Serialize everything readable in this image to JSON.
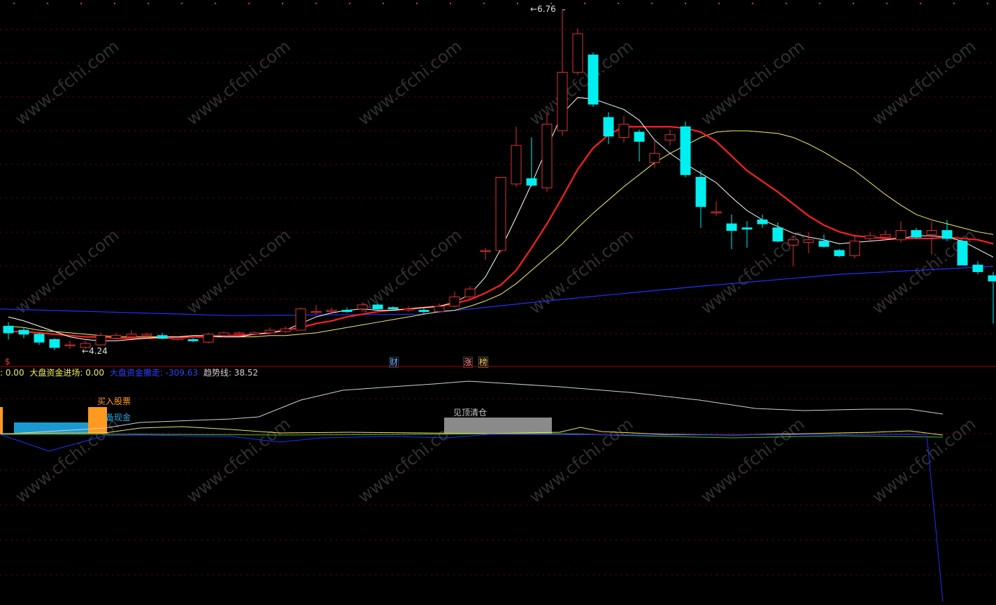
{
  "colors": {
    "background": "#000000",
    "grid": "#7a0000",
    "up": "#e0303a",
    "down": "#00f0f0",
    "ma5": "#ffffff",
    "ma10": "#ff2020",
    "ma20": "#f0f060",
    "ma60": "#2030ff",
    "divider": "#b00000"
  },
  "price": {
    "high_label": "6.76",
    "low_label": "4.24",
    "high_marker_arrow": "←",
    "low_marker_arrow": "←"
  },
  "event_markers": [
    {
      "text": "$",
      "color": "#ff3030"
    },
    {
      "text": "财",
      "color": "#60c0ff"
    },
    {
      "text": "涨",
      "color": "#ff9090"
    },
    {
      "text": "榜",
      "color": "#ffd070"
    }
  ],
  "indicator_bar": {
    "items": [
      {
        "label": ": 0.00",
        "color": "#f0f060"
      },
      {
        "label": "大盘资金进场: 0.00",
        "color": "#f0f060"
      },
      {
        "label": "大盘资金撤走: -309.63",
        "color": "#3040ff"
      },
      {
        "label": "趋势线: 38.52",
        "color": "#d0d0d0"
      }
    ]
  },
  "signals": {
    "buy_label": "买入股票",
    "hold_cash_label": "备现金",
    "top_clear_label": "见顶清仓"
  },
  "watermark": "www.cfchi.com",
  "chart_data": {
    "type": "candlestick",
    "y_high": 6.76,
    "y_low": 4.24,
    "candles": [
      {
        "o": 4.38,
        "c": 4.33,
        "h": 4.41,
        "l": 4.28
      },
      {
        "o": 4.35,
        "c": 4.32,
        "h": 4.37,
        "l": 4.29
      },
      {
        "o": 4.32,
        "c": 4.26,
        "h": 4.33,
        "l": 4.24
      },
      {
        "o": 4.28,
        "c": 4.22,
        "h": 4.29,
        "l": 4.2
      },
      {
        "o": 4.24,
        "c": 4.24,
        "h": 4.27,
        "l": 4.21
      },
      {
        "o": 4.22,
        "c": 4.25,
        "h": 4.27,
        "l": 4.21
      },
      {
        "o": 4.24,
        "c": 4.31,
        "h": 4.33,
        "l": 4.24
      },
      {
        "o": 4.29,
        "c": 4.31,
        "h": 4.33,
        "l": 4.28
      },
      {
        "o": 4.3,
        "c": 4.32,
        "h": 4.35,
        "l": 4.29
      },
      {
        "o": 4.31,
        "c": 4.32,
        "h": 4.33,
        "l": 4.29
      },
      {
        "o": 4.31,
        "c": 4.29,
        "h": 4.33,
        "l": 4.28
      },
      {
        "o": 4.28,
        "c": 4.29,
        "h": 4.3,
        "l": 4.27
      },
      {
        "o": 4.28,
        "c": 4.27,
        "h": 4.29,
        "l": 4.26
      },
      {
        "o": 4.26,
        "c": 4.32,
        "h": 4.33,
        "l": 4.25
      },
      {
        "o": 4.31,
        "c": 4.33,
        "h": 4.34,
        "l": 4.3
      },
      {
        "o": 4.32,
        "c": 4.33,
        "h": 4.34,
        "l": 4.31
      },
      {
        "o": 4.32,
        "c": 4.33,
        "h": 4.34,
        "l": 4.31
      },
      {
        "o": 4.33,
        "c": 4.35,
        "h": 4.37,
        "l": 4.32
      },
      {
        "o": 4.34,
        "c": 4.36,
        "h": 4.38,
        "l": 4.33
      },
      {
        "o": 4.35,
        "c": 4.51,
        "h": 4.52,
        "l": 4.35
      },
      {
        "o": 4.49,
        "c": 4.49,
        "h": 4.54,
        "l": 4.47
      },
      {
        "o": 4.49,
        "c": 4.5,
        "h": 4.52,
        "l": 4.47
      },
      {
        "o": 4.5,
        "c": 4.49,
        "h": 4.52,
        "l": 4.48
      },
      {
        "o": 4.51,
        "c": 4.54,
        "h": 4.56,
        "l": 4.49
      },
      {
        "o": 4.54,
        "c": 4.51,
        "h": 4.55,
        "l": 4.5
      },
      {
        "o": 4.52,
        "c": 4.51,
        "h": 4.53,
        "l": 4.5
      },
      {
        "o": 4.51,
        "c": 4.51,
        "h": 4.53,
        "l": 4.49
      },
      {
        "o": 4.5,
        "c": 4.49,
        "h": 4.52,
        "l": 4.47
      },
      {
        "o": 4.49,
        "c": 4.53,
        "h": 4.55,
        "l": 4.48
      },
      {
        "o": 4.53,
        "c": 4.6,
        "h": 4.64,
        "l": 4.52
      },
      {
        "o": 4.6,
        "c": 4.66,
        "h": 4.68,
        "l": 4.58
      },
      {
        "o": 4.95,
        "c": 4.95,
        "h": 4.97,
        "l": 4.88
      },
      {
        "o": 4.95,
        "c": 5.5,
        "h": 5.5,
        "l": 4.93
      },
      {
        "o": 5.45,
        "c": 5.74,
        "h": 5.88,
        "l": 5.43
      },
      {
        "o": 5.49,
        "c": 5.44,
        "h": 5.8,
        "l": 5.43
      },
      {
        "o": 5.42,
        "c": 5.9,
        "h": 5.98,
        "l": 5.39
      },
      {
        "o": 5.85,
        "c": 6.29,
        "h": 6.76,
        "l": 5.81
      },
      {
        "o": 6.29,
        "c": 6.58,
        "h": 6.62,
        "l": 6.27
      },
      {
        "o": 6.42,
        "c": 6.05,
        "h": 6.44,
        "l": 6.03
      },
      {
        "o": 5.95,
        "c": 5.81,
        "h": 5.99,
        "l": 5.75
      },
      {
        "o": 5.8,
        "c": 5.9,
        "h": 5.96,
        "l": 5.76
      },
      {
        "o": 5.84,
        "c": 5.77,
        "h": 5.86,
        "l": 5.62
      },
      {
        "o": 5.61,
        "c": 5.68,
        "h": 5.78,
        "l": 5.57
      },
      {
        "o": 5.78,
        "c": 5.82,
        "h": 5.86,
        "l": 5.74
      },
      {
        "o": 5.88,
        "c": 5.52,
        "h": 5.92,
        "l": 5.5
      },
      {
        "o": 5.5,
        "c": 5.28,
        "h": 5.55,
        "l": 5.12
      },
      {
        "o": 5.24,
        "c": 5.24,
        "h": 5.32,
        "l": 5.21
      },
      {
        "o": 5.15,
        "c": 5.1,
        "h": 5.22,
        "l": 4.96
      },
      {
        "o": 5.12,
        "c": 5.11,
        "h": 5.17,
        "l": 4.97
      },
      {
        "o": 5.18,
        "c": 5.15,
        "h": 5.22,
        "l": 5.12
      },
      {
        "o": 5.12,
        "c": 5.02,
        "h": 5.16,
        "l": 5.01
      },
      {
        "o": 4.99,
        "c": 5.03,
        "h": 5.06,
        "l": 4.83
      },
      {
        "o": 5.01,
        "c": 5.03,
        "h": 5.09,
        "l": 4.93
      },
      {
        "o": 5.02,
        "c": 4.98,
        "h": 5.07,
        "l": 4.97
      },
      {
        "o": 4.95,
        "c": 4.91,
        "h": 4.96,
        "l": 4.9
      },
      {
        "o": 4.91,
        "c": 5.02,
        "h": 5.06,
        "l": 4.89
      },
      {
        "o": 5.04,
        "c": 5.06,
        "h": 5.09,
        "l": 5.01
      },
      {
        "o": 5.05,
        "c": 5.07,
        "h": 5.1,
        "l": 5.03
      },
      {
        "o": 5.03,
        "c": 5.1,
        "h": 5.17,
        "l": 5.01
      },
      {
        "o": 5.1,
        "c": 5.05,
        "h": 5.12,
        "l": 5.04
      },
      {
        "o": 5.07,
        "c": 5.1,
        "h": 5.17,
        "l": 4.92
      },
      {
        "o": 5.1,
        "c": 5.04,
        "h": 5.18,
        "l": 5.02
      },
      {
        "o": 5.02,
        "c": 4.84,
        "h": 5.03,
        "l": 4.84
      },
      {
        "o": 4.84,
        "c": 4.79,
        "h": 4.87,
        "l": 4.77
      },
      {
        "o": 4.76,
        "c": 4.72,
        "h": 4.79,
        "l": 4.4
      }
    ],
    "ma5": [
      4.45,
      4.42,
      4.38,
      4.34,
      4.3,
      4.28,
      4.27,
      4.27,
      4.28,
      4.29,
      4.3,
      4.3,
      4.31,
      4.31,
      4.3,
      4.3,
      4.32,
      4.33,
      4.35,
      4.4,
      4.45,
      4.48,
      4.5,
      4.51,
      4.5,
      4.5,
      4.51,
      4.52,
      4.53,
      4.56,
      4.62,
      4.75,
      4.96,
      5.2,
      5.45,
      5.72,
      5.98,
      6.1,
      6.09,
      6.05,
      6.01,
      5.93,
      5.78,
      5.68,
      5.6,
      5.53,
      5.46,
      5.35,
      5.25,
      5.18,
      5.13,
      5.08,
      5.05,
      5.03,
      5.0,
      5.01,
      5.02,
      5.03,
      5.04,
      5.06,
      5.06,
      5.05,
      5.02,
      4.96,
      4.9
    ],
    "ma10": [
      4.34,
      4.34,
      4.33,
      4.32,
      4.31,
      4.3,
      4.3,
      4.29,
      4.29,
      4.29,
      4.29,
      4.29,
      4.3,
      4.3,
      4.31,
      4.31,
      4.32,
      4.33,
      4.35,
      4.37,
      4.4,
      4.42,
      4.45,
      4.47,
      4.49,
      4.5,
      4.51,
      4.52,
      4.53,
      4.55,
      4.58,
      4.63,
      4.69,
      4.8,
      4.97,
      5.15,
      5.35,
      5.56,
      5.72,
      5.82,
      5.88,
      5.88,
      5.88,
      5.88,
      5.87,
      5.84,
      5.77,
      5.66,
      5.55,
      5.47,
      5.39,
      5.3,
      5.21,
      5.14,
      5.09,
      5.06,
      5.05,
      5.04,
      5.04,
      5.04,
      5.04,
      5.05,
      5.04,
      5.03,
      5.0
    ],
    "ma20": [
      4.38,
      4.37,
      4.35,
      4.34,
      4.33,
      4.32,
      4.31,
      4.3,
      4.3,
      4.3,
      4.3,
      4.3,
      4.3,
      4.3,
      4.3,
      4.3,
      4.3,
      4.31,
      4.31,
      4.32,
      4.33,
      4.35,
      4.37,
      4.39,
      4.41,
      4.43,
      4.45,
      4.47,
      4.49,
      4.5,
      4.53,
      4.57,
      4.62,
      4.7,
      4.8,
      4.9,
      5.0,
      5.12,
      5.23,
      5.33,
      5.43,
      5.52,
      5.61,
      5.68,
      5.74,
      5.8,
      5.84,
      5.85,
      5.85,
      5.84,
      5.83,
      5.8,
      5.75,
      5.69,
      5.62,
      5.55,
      5.46,
      5.37,
      5.29,
      5.22,
      5.18,
      5.15,
      5.12,
      5.09,
      5.07
    ],
    "ma60_start": 4.51,
    "ma60_end": 4.83,
    "lower_lines": {
      "white_trend_start": 38,
      "white_trend_peak": 62,
      "white_trend_end": 38.52
    }
  }
}
